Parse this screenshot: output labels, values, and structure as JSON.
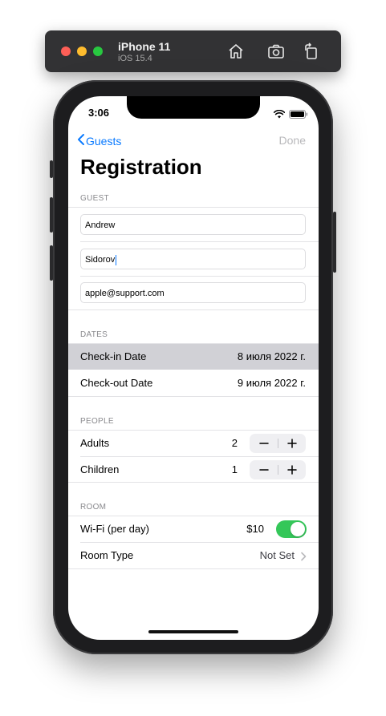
{
  "simulator": {
    "device": "iPhone 11",
    "os": "iOS 15.4",
    "icons": [
      "home-icon",
      "screenshot-icon",
      "rotate-icon"
    ]
  },
  "status_bar": {
    "time": "3:06",
    "icons": [
      "wifi-icon",
      "battery-icon"
    ]
  },
  "nav": {
    "back_label": "Guests",
    "done_label": "Done",
    "title": "Registration"
  },
  "sections": {
    "guest": {
      "header": "GUEST",
      "first_name": "Andrew",
      "last_name": "Sidorov",
      "email": "apple@support.com"
    },
    "dates": {
      "header": "DATES",
      "check_in_label": "Check-in Date",
      "check_in_value": "8 июля 2022 г.",
      "check_out_label": "Check-out Date",
      "check_out_value": "9 июля 2022 г."
    },
    "people": {
      "header": "PEOPLE",
      "adults_label": "Adults",
      "adults_value": "2",
      "children_label": "Children",
      "children_value": "1"
    },
    "room": {
      "header": "ROOM",
      "wifi_label": "Wi-Fi (per day)",
      "wifi_price": "$10",
      "wifi_enabled": true,
      "room_type_label": "Room Type",
      "room_type_value": "Not Set"
    }
  },
  "colors": {
    "accent": "#0a7aff",
    "toggle_on": "#34c759",
    "selected_row": "#d1d1d6"
  }
}
